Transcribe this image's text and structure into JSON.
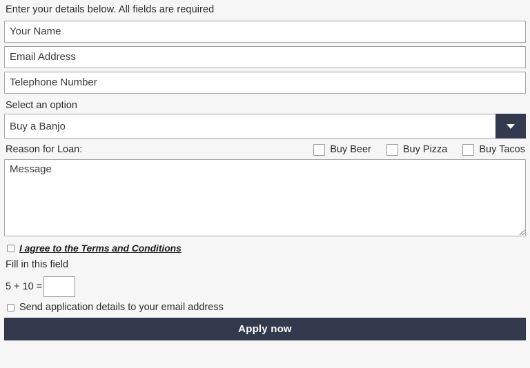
{
  "form": {
    "intro": "Enter your details below. All fields are required",
    "fields": [
      {
        "name": "your-name",
        "placeholder": "Your Name",
        "value": ""
      },
      {
        "name": "email-address",
        "placeholder": "Email Address",
        "value": ""
      },
      {
        "name": "telephone-number",
        "placeholder": "Telephone Number",
        "value": ""
      }
    ],
    "select": {
      "label": "Select an option",
      "selected": "Buy a Banjo",
      "arrow_icon": "chevron-down-icon"
    },
    "reason": {
      "label": "Reason for Loan:",
      "checkboxes": [
        {
          "label": "Buy Beer",
          "checked": false
        },
        {
          "label": "Buy Pizza",
          "checked": false
        },
        {
          "label": "Buy Tacos",
          "checked": false
        }
      ]
    },
    "message": {
      "placeholder": "Message",
      "value": ""
    },
    "terms": {
      "link_text": "I agree to the Terms and Conditions",
      "checked": false
    },
    "captcha": {
      "label": "Fill in this field",
      "expression": "5 + 10 =",
      "value": ""
    },
    "send_copy": {
      "label": "Send application details to your email address",
      "checked": false
    },
    "submit": {
      "label": "Apply now"
    }
  },
  "colors": {
    "accent_dark": "#343a4e",
    "page_background": "#f6f6f6",
    "field_border": "#a9a9a9",
    "text": "#2b2b2b"
  }
}
